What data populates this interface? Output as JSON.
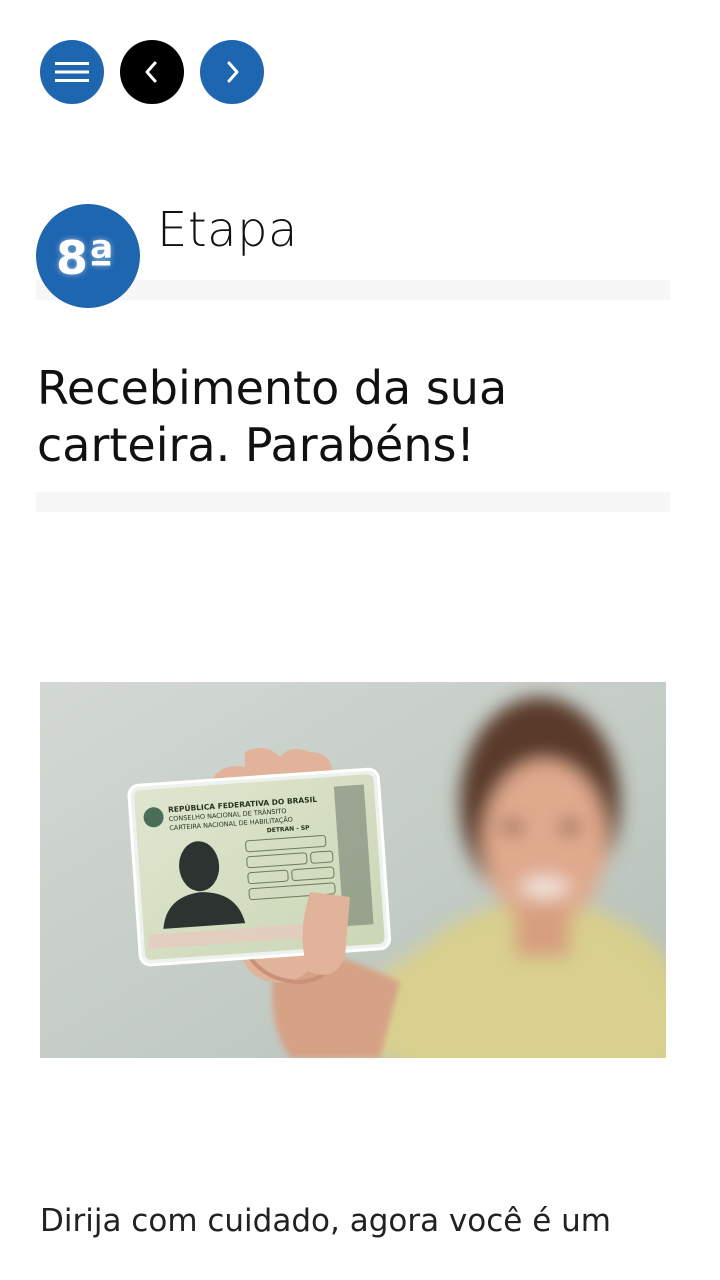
{
  "nav": {
    "menu_icon": "hamburger-menu-icon",
    "prev_icon": "chevron-left-icon",
    "next_icon": "chevron-right-icon",
    "colors": {
      "primary": "#1f66b0",
      "active": "#000000"
    }
  },
  "step": {
    "number": "8ª",
    "label": "Etapa"
  },
  "headline": "Recebimento da sua carteira. Parabéns!",
  "card": {
    "line1": "REPÚBLICA FEDERATIVA DO BRASIL",
    "line2": "CONSELHO NACIONAL DE TRÂNSITO",
    "line3": "CARTEIRA NACIONAL DE HABILITAÇÃO",
    "line4": "DETRAN - SP"
  },
  "body_text": "Dirija com cuidado, agora você é um"
}
